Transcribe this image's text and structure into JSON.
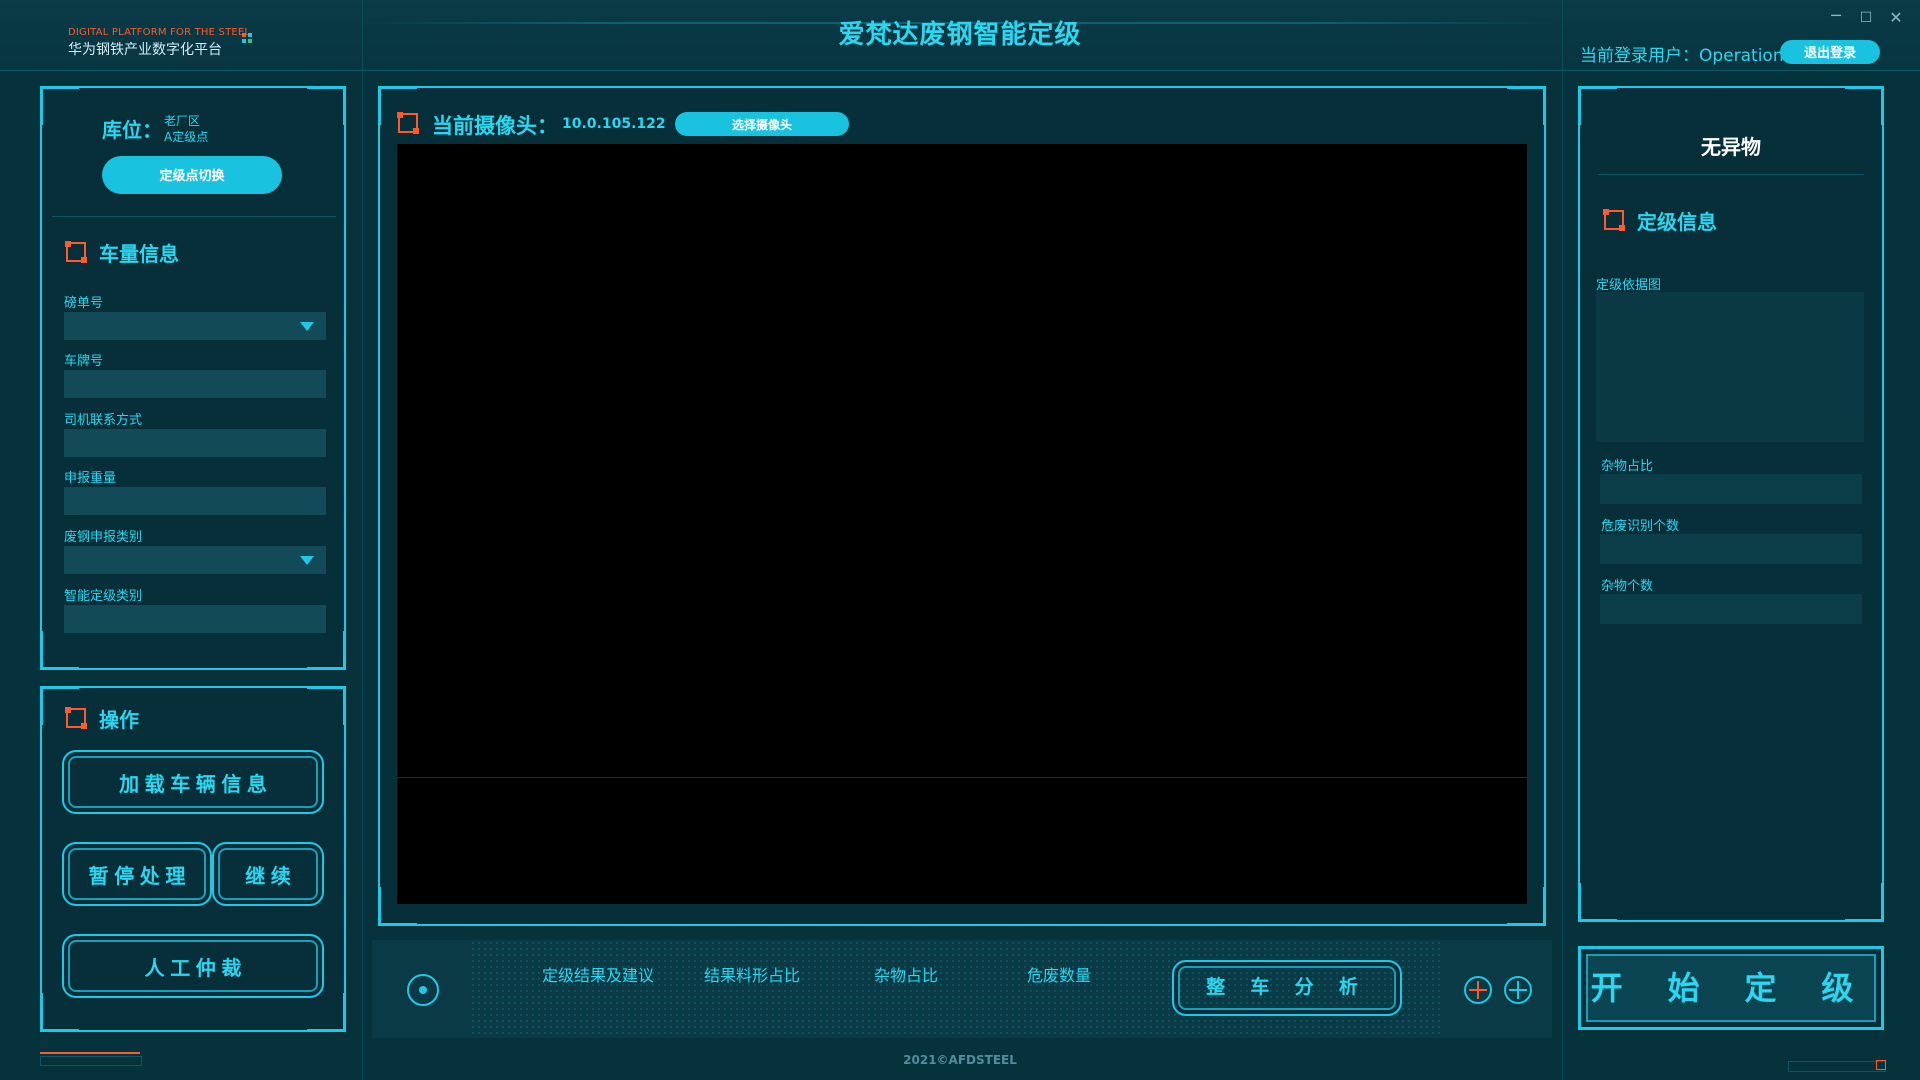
{
  "brand": {
    "en": "DIGITAL PLATFORM FOR THE STEEL",
    "cn": "华为钢铁产业数字化平台"
  },
  "app_title": "爱梵达废钢智能定级",
  "window": {
    "minimize": "─",
    "maximize": "☐",
    "close": "✕"
  },
  "user": {
    "label": "当前登录用户：Operation",
    "logout": "退出登录"
  },
  "storage": {
    "label": "库位：",
    "area": "老厂区",
    "point": "A定级点",
    "switch_button": "定级点切换"
  },
  "vehicle": {
    "title": "车量信息",
    "fields": [
      {
        "label": "磅单号",
        "value": ""
      },
      {
        "label": "车牌号",
        "value": ""
      },
      {
        "label": "司机联系方式",
        "value": ""
      },
      {
        "label": "申报重量",
        "value": ""
      },
      {
        "label": "废钢申报类别",
        "value": ""
      },
      {
        "label": "智能定级类别",
        "value": ""
      }
    ]
  },
  "operations": {
    "title": "操作",
    "load_vehicle": "加 载 车 辆 信 息",
    "pause": "暂 停 处 理",
    "resume": "继 续",
    "manual": "人 工 仲 裁"
  },
  "camera": {
    "label": "当前摄像头：",
    "ip": "10.0.105.122",
    "select_button": "选择摄像头"
  },
  "tabs": [
    "定级结果及建议",
    "结果料形占比",
    "杂物占比",
    "危废数量"
  ],
  "whole_analysis": "整 车 分 析",
  "footer": "2021©AFDSTEEL",
  "right": {
    "status": "无异物",
    "title": "定级信息",
    "basis_image": "定级依据图",
    "impurity_ratio": "杂物占比",
    "hazard_count": "危废识别个数",
    "impurity_count": "杂物个数"
  },
  "start_button": "开 始 定 级",
  "colors": {
    "accent": "#1ec8e6",
    "accent_text": "#2ad6f0",
    "warning": "#ff5a2a",
    "background": "#06323c"
  }
}
